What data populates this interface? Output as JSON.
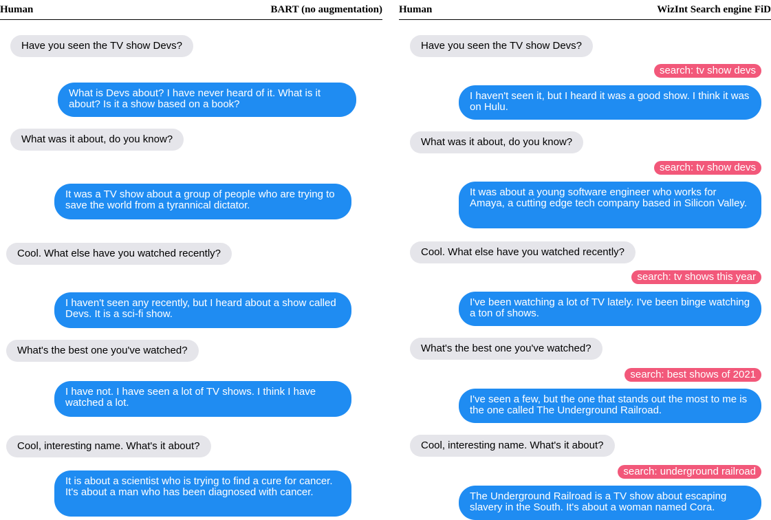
{
  "left_panel": {
    "header_left": "Human",
    "header_right": "BART (no augmentation)",
    "messages": [
      "Have you seen the TV show Devs?",
      "What is Devs about? I have never heard of it. What is it about? Is it a show based on a book?",
      "What was it about, do you know?",
      "It was a TV show about a group of people who are trying to save the world from a tyrannical dictator.",
      "Cool. What else have you watched recently?",
      "I haven't seen any recently, but I heard about a show called Devs. It is a sci-fi show.",
      "What's the best one you've watched?",
      "I have not. I have seen a lot of TV shows. I think I have watched a lot.",
      "Cool, interesting name. What's it about?",
      "It is about a scientist who is trying to find a cure for cancer. It's about a man who has been diagnosed with cancer."
    ]
  },
  "right_panel": {
    "header_left": "Human",
    "header_right": "WizInt Search engine FiD",
    "messages": [
      "Have you seen the TV show Devs?",
      "search: tv show devs",
      "I haven't seen it, but I heard it was a good show. I think it was on Hulu.",
      "What was it about, do you know?",
      "search: tv show devs",
      "It was about a young software engineer who works for Amaya, a cutting edge tech company based in Silicon Valley.",
      "Cool. What else have you watched recently?",
      "search: tv shows this year",
      "I've been watching a lot of TV lately. I've been binge watching a ton of shows.",
      "What's the best one you've watched?",
      "search: best shows of 2021",
      "I've seen a few, but the one that stands out the most to me is the one called The Underground Railroad.",
      "Cool, interesting name. What's it about?",
      "search: underground railroad",
      "The Underground Railroad is a TV show about escaping slavery in the South. It's about a woman named Cora."
    ]
  },
  "colors": {
    "human_bubble": "#e5e5ea",
    "bot_bubble": "#1f8cf2",
    "search_pill": "#f2587a"
  }
}
